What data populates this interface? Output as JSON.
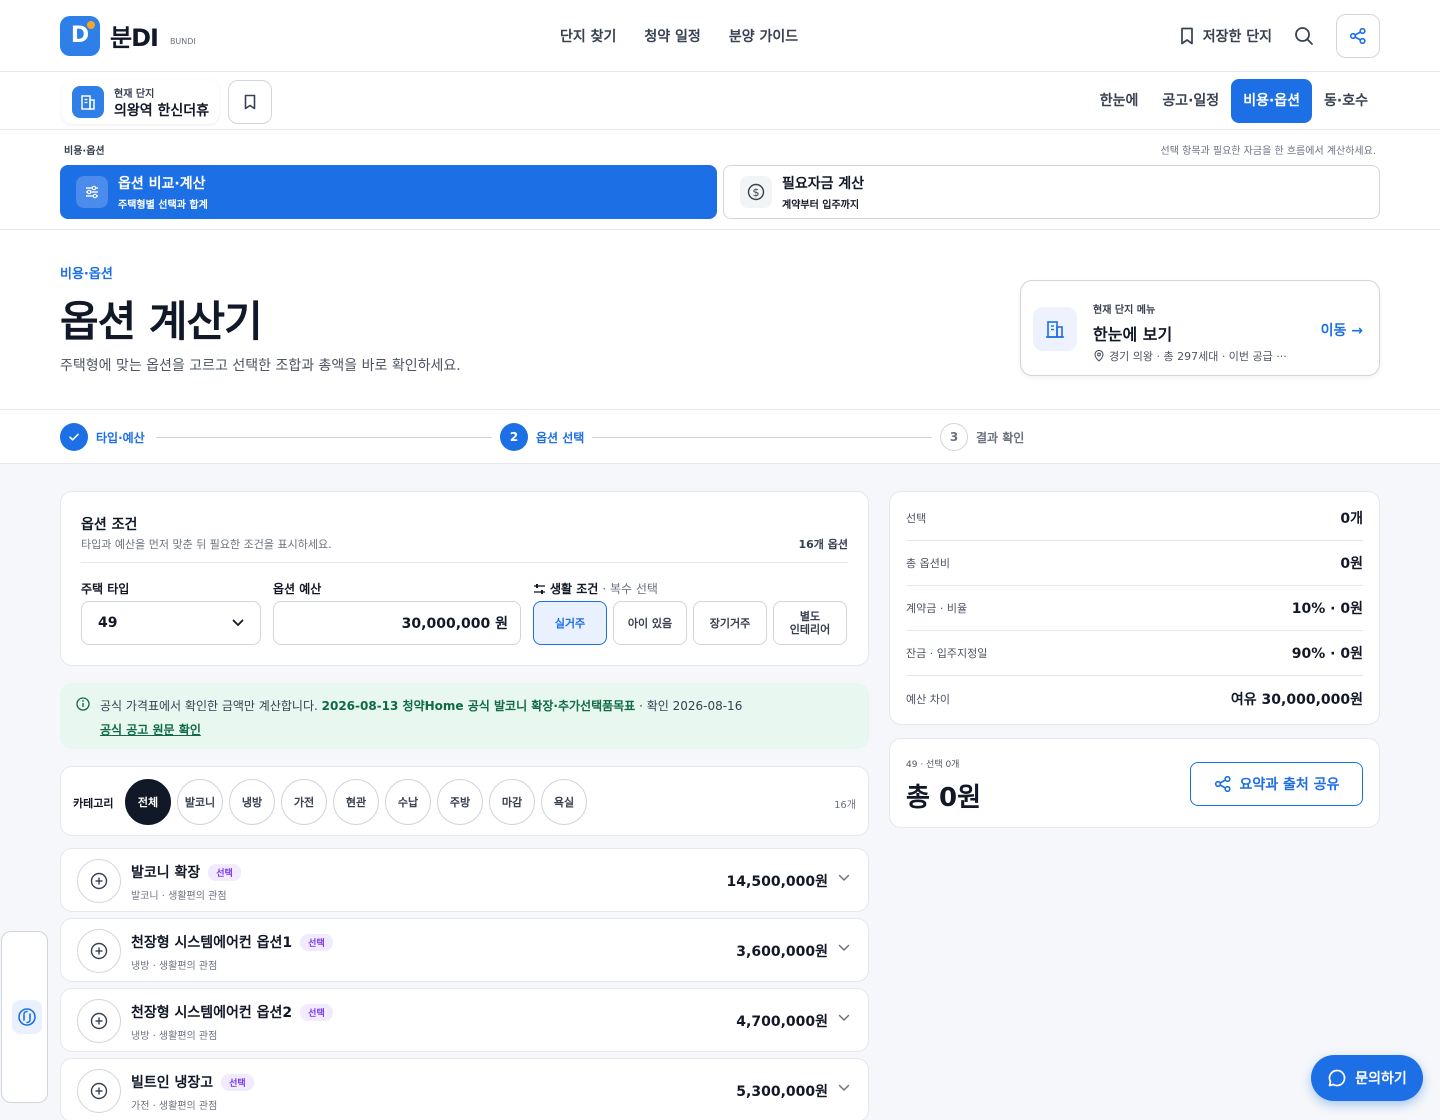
{
  "brand": {
    "name": "분DI",
    "sub": "BUNDI",
    "accent": "#1d6fe6"
  },
  "nav": {
    "items": [
      "단지 찾기",
      "청약 일정",
      "분양 가이드"
    ],
    "saved": "저장한 단지"
  },
  "current": {
    "label": "현재 단지",
    "name": "의왕역 한신더휴"
  },
  "subtabs": [
    "한눈에",
    "공고·일정",
    "비용·옵션",
    "동·호수"
  ],
  "section": {
    "crumb": "비용·옵션",
    "hint": "선택 항목과 필요한 자금을 한 흐름에서 계산하세요.",
    "tab_a": {
      "title": "옵션 비교·계산",
      "sub": "주택형별 선택과 합계"
    },
    "tab_b": {
      "title": "필요자금 계산",
      "sub": "계약부터 입주까지"
    }
  },
  "hero": {
    "kicker": "비용·옵션",
    "title": "옵션 계산기",
    "desc": "주택형에 맞는 옵션을 고르고 선택한 조합과 총액을 바로 확인하세요.",
    "menu_label": "현재 단지 메뉴",
    "menu_title": "한눈에 보기",
    "menu_sub": "경기 의왕 · 총 297세대 · 이번 공급 ···",
    "menu_go": "이동 →"
  },
  "steps": [
    {
      "num": "",
      "label": "타입·예산"
    },
    {
      "num": "2",
      "label": "옵션 선택"
    },
    {
      "num": "3",
      "label": "결과 확인"
    }
  ],
  "conditions": {
    "title": "옵션 조건",
    "sub": "타입과 예산을 먼저 맞춘 뒤 필요한 조건을 표시하세요.",
    "count": "16개 옵션",
    "type_label": "주택 타입",
    "type_value": "49",
    "budget_label": "옵션 예산",
    "budget_value": "30,000,000 원",
    "life_label": "생활 조건",
    "life_hint": "· 복수 선택",
    "life_chips": [
      "실거주",
      "아이 있음",
      "장기거주",
      "별도\n인테리어"
    ]
  },
  "notice": {
    "pre": "공식 가격표에서 확인한 금액만 계산합니다.",
    "source": "2026-08-13 청약Home 공식 발코니 확장·추가선택품목표",
    "post": "· 확인 2026-08-16",
    "link": "공식 공고 원문 확인"
  },
  "categories": {
    "label": "카테고리",
    "items": [
      "전체",
      "발코니",
      "냉방",
      "가전",
      "현관",
      "수납",
      "주방",
      "마감",
      "욕실"
    ],
    "count": "16개"
  },
  "options": [
    {
      "name": "발코니 확장",
      "badge": "선택",
      "meta": "발코니 · 생활편의 관점",
      "price": "14,500,000원"
    },
    {
      "name": "천장형 시스템에어컨 옵션1",
      "badge": "선택",
      "meta": "냉방 · 생활편의 관점",
      "price": "3,600,000원"
    },
    {
      "name": "천장형 시스템에어컨 옵션2",
      "badge": "선택",
      "meta": "냉방 · 생활편의 관점",
      "price": "4,700,000원"
    },
    {
      "name": "빌트인 냉장고",
      "badge": "선택",
      "meta": "가전 · 생활편의 관점",
      "price": "5,300,000원"
    }
  ],
  "summary": [
    {
      "k": "선택",
      "v": "0개"
    },
    {
      "k": "총 옵션비",
      "v": "0원"
    },
    {
      "k": "계약금 · 비율",
      "v": "10% · 0원"
    },
    {
      "k": "잔금 · 입주지정일",
      "v": "90% · 0원"
    },
    {
      "k": "예산 차이",
      "v": "여유 30,000,000원"
    }
  ],
  "total": {
    "meta": "49 · 선택 0개",
    "amount": "총 0원",
    "share": "요약과 출처 공유"
  },
  "fab": "문의하기"
}
